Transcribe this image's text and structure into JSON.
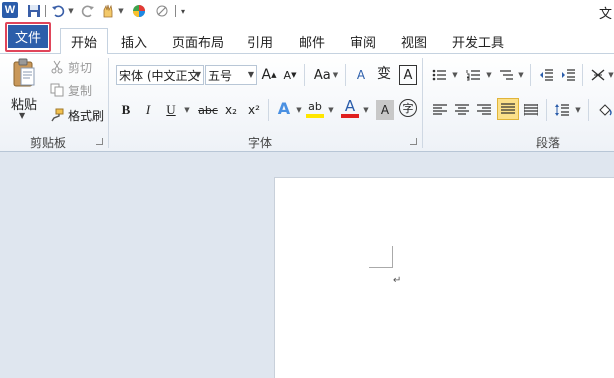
{
  "qat": {
    "app_logo": "W",
    "title_fragment": "文"
  },
  "tabs": {
    "file": "文件",
    "items": [
      {
        "label": "开始",
        "active": true
      },
      {
        "label": "插入"
      },
      {
        "label": "页面布局"
      },
      {
        "label": "引用"
      },
      {
        "label": "邮件"
      },
      {
        "label": "审阅"
      },
      {
        "label": "视图"
      },
      {
        "label": "开发工具"
      }
    ]
  },
  "clipboard": {
    "paste": "粘贴",
    "cut": "剪切",
    "copy": "复制",
    "format_painter": "格式刷",
    "group_label": "剪贴板"
  },
  "font": {
    "font_name": "宋体 (中文正文",
    "font_size": "五号",
    "grow": "A",
    "shrink": "A",
    "change_case": "Aa",
    "clear_format": "A",
    "phonetic": "变",
    "border_char": "A",
    "bold": "B",
    "italic": "I",
    "underline": "U",
    "strikethrough": "abc",
    "subscript": "x₂",
    "superscript": "x²",
    "text_effect": "A",
    "highlight": "ab",
    "font_color": "A",
    "char_shading": "A",
    "enclose_char": "字",
    "group_label": "字体",
    "highlight_color": "#ffe600",
    "font_color_value": "#e02020"
  },
  "paragraph": {
    "group_label": "段落"
  }
}
